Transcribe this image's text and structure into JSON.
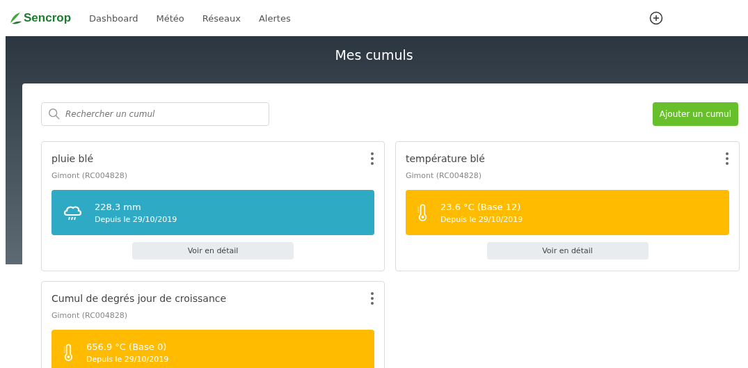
{
  "brand": {
    "name": "Sencrop"
  },
  "nav": [
    {
      "label": "Dashboard"
    },
    {
      "label": "Météo"
    },
    {
      "label": "Réseaux"
    },
    {
      "label": "Alertes"
    }
  ],
  "page": {
    "title": "Mes cumuls"
  },
  "search": {
    "placeholder": "Rechercher un cumul"
  },
  "add_button": "Ajouter un cumul",
  "cards": [
    {
      "title": "pluie blé",
      "station": "Gimont (RC004828)",
      "kind": "rain",
      "value": "228.3 mm",
      "since": "Depuis le 29/10/2019",
      "action": "Voir en détail"
    },
    {
      "title": "température blé",
      "station": "Gimont (RC004828)",
      "kind": "temperature",
      "value": "23.6 °C (Base 12)",
      "since": "Depuis le 29/10/2019",
      "action": "Voir en détail"
    },
    {
      "title": "Cumul de degrés jour de croissance",
      "station": "Gimont (RC004828)",
      "kind": "temperature",
      "value": "656.9 °C (Base 0)",
      "since": "Depuis le 29/10/2019"
    }
  ]
}
